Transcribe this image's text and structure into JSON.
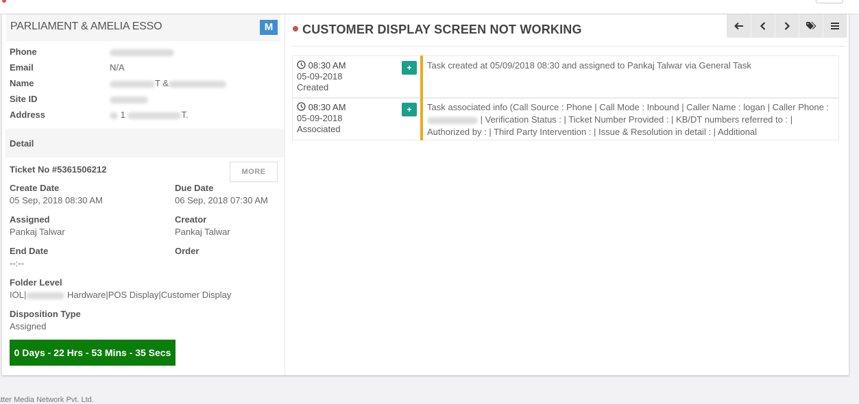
{
  "customer": {
    "name": "PARLIAMENT & AMELIA ESSO",
    "badge": "M",
    "fields": [
      {
        "label": "Phone",
        "value": ""
      },
      {
        "label": "Email",
        "value": "N/A"
      },
      {
        "label": "Name",
        "value": "T &"
      },
      {
        "label": "Site ID",
        "value": ""
      },
      {
        "label": "Address",
        "value": "1"
      }
    ],
    "address_suffix": "T."
  },
  "detail": {
    "heading": "Detail",
    "ticket_no": "Ticket No #5361506212",
    "more_label": "MORE",
    "create_date_label": "Create Date",
    "create_date": "05 Sep, 2018 08:30 AM",
    "due_date_label": "Due Date",
    "due_date": "06 Sep, 2018 07:30 AM",
    "assigned_label": "Assigned",
    "assigned": "Pankaj Talwar",
    "creator_label": "Creator",
    "creator": "Pankaj Talwar",
    "end_date_label": "End Date",
    "end_date": "--:--",
    "order_label": "Order",
    "folder_level_label": "Folder Level",
    "folder_prefix": "IOL|",
    "folder_rest": "Hardware|POS Display|Customer Display",
    "disposition_label": "Disposition Type",
    "disposition": "Assigned",
    "timer": "0 Days - 22 Hrs - 53 Mins - 35 Secs"
  },
  "ticket": {
    "title": "CUSTOMER DISPLAY SCREEN NOT WORKING",
    "status_color": "#c9534f"
  },
  "toolbar": {
    "icons": [
      "arrow-left-icon",
      "chevron-left-icon",
      "chevron-right-icon",
      "tags-icon",
      "menu-icon"
    ]
  },
  "timeline": [
    {
      "time": "08:30 AM",
      "date": "05-09-2018",
      "type": "Created",
      "text": "Task created at 05/09/2018 08:30 and assigned to Pankaj Talwar via General Task"
    },
    {
      "time": "08:30 AM",
      "date": "05-09-2018",
      "type": "Associated",
      "text_before": "Task associated info (Call Source : Phone | Call Mode : Inbound | Caller Name : logan | Caller Phone :",
      "text_after": "| Verification Status : | Ticket Number Provided : | KB/DT numbers referred to : | Authorized by : | Third Party Intervention : | Issue & Resolution in detail : | Additional"
    }
  ],
  "footer": {
    "text": "atter Media Network Pvt. Ltd."
  },
  "colors": {
    "accent": "#3e8ed0",
    "timer": "#0a7d0a",
    "timeline_bar": "#f0a81c",
    "plus": "#1b9e8c"
  }
}
